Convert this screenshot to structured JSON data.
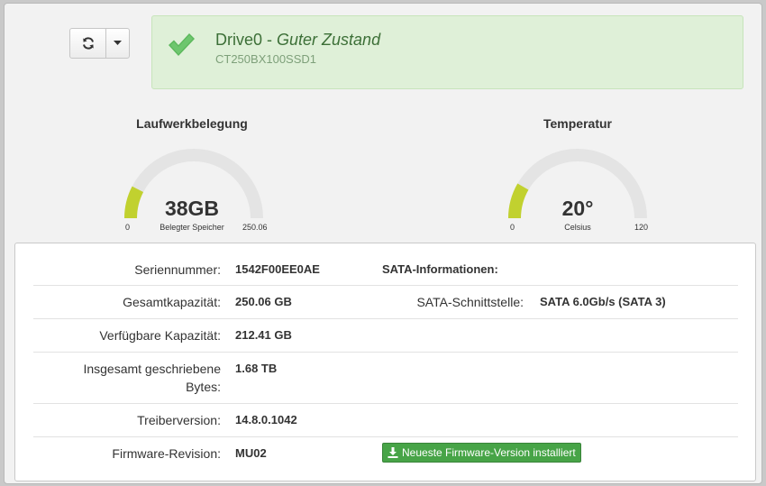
{
  "toolbar": {
    "refresh_icon": "refresh-icon",
    "caret_icon": "caret-down-icon"
  },
  "status": {
    "icon": "checkmark-icon",
    "drive": "Drive0",
    "separator": " - ",
    "state": "Guter Zustand",
    "model": "CT250BX100SSD1",
    "colors": {
      "background": "#dff0d8",
      "text": "#3c6f37",
      "check": "#5cb85c"
    }
  },
  "gauges": {
    "usage": {
      "title": "Laufwerkbelegung",
      "value": "38GB",
      "unit": "Belegter Speicher",
      "min": "0",
      "max": "250.06",
      "fraction": 0.152
    },
    "temp": {
      "title": "Temperatur",
      "value": "20°",
      "unit": "Celsius",
      "min": "0",
      "max": "120",
      "fraction": 0.1667
    },
    "colors": {
      "fill": "#c1d12f",
      "track": "#e4e4e4"
    }
  },
  "info": {
    "serial": {
      "label": "Seriennummer:",
      "value": "1542F00EE0AE"
    },
    "sata_heading": "SATA-Informationen:",
    "capacity": {
      "label": "Gesamtkapazität:",
      "value": "250.06 GB"
    },
    "sata_interface": {
      "label": "SATA-Schnittstelle:",
      "value": "SATA 6.0Gb/s (SATA 3)"
    },
    "available": {
      "label": "Verfügbare Kapazität:",
      "value": "212.41 GB"
    },
    "written": {
      "label_line1": "Insgesamt geschriebene",
      "label_line2": "Bytes:",
      "value": "1.68 TB"
    },
    "driver": {
      "label": "Treiberversion:",
      "value": "14.8.0.1042"
    },
    "firmware": {
      "label": "Firmware-Revision:",
      "value": "MU02",
      "button": "Neueste Firmware-Version installiert",
      "button_icon": "download-icon"
    }
  }
}
